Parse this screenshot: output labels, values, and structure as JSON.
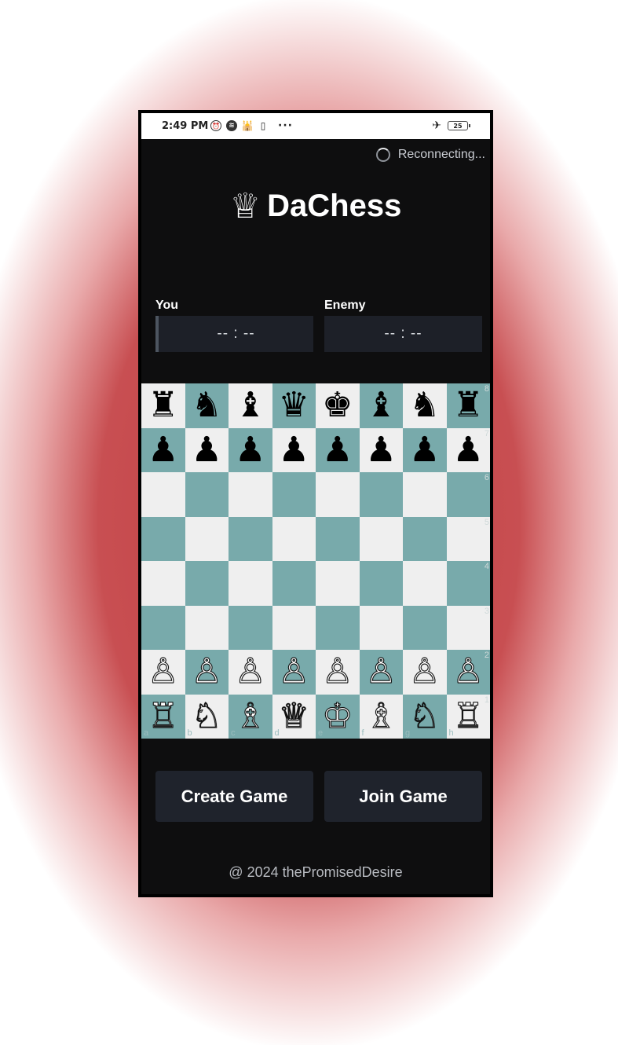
{
  "status_bar": {
    "time": "2:49 PM",
    "icons": [
      "alarm-icon",
      "spotify-icon",
      "mosque-icon",
      "twitch-icon"
    ],
    "more": "···",
    "battery": "25",
    "airplane": "✈"
  },
  "connection": {
    "status": "Reconnecting..."
  },
  "app": {
    "logo_glyph": "♕",
    "title": "DaChess"
  },
  "players": {
    "you": {
      "label": "You",
      "timer": "-- : --"
    },
    "enemy": {
      "label": "Enemy",
      "timer": "-- : --"
    }
  },
  "board": {
    "colors": {
      "light": "#efefef",
      "dark": "#78aaab"
    },
    "files": [
      "a",
      "b",
      "c",
      "d",
      "e",
      "f",
      "g",
      "h"
    ],
    "ranks": [
      "8",
      "7",
      "6",
      "5",
      "4",
      "3",
      "2",
      "1"
    ],
    "position": [
      [
        "♜",
        "♞",
        "♝",
        "♛",
        "♚",
        "♝",
        "♞",
        "♜"
      ],
      [
        "♟",
        "♟",
        "♟",
        "♟",
        "♟",
        "♟",
        "♟",
        "♟"
      ],
      [
        "",
        "",
        "",
        "",
        "",
        "",
        "",
        ""
      ],
      [
        "",
        "",
        "",
        "",
        "",
        "",
        "",
        ""
      ],
      [
        "",
        "",
        "",
        "",
        "",
        "",
        "",
        ""
      ],
      [
        "",
        "",
        "",
        "",
        "",
        "",
        "",
        ""
      ],
      [
        "♙",
        "♙",
        "♙",
        "♙",
        "♙",
        "♙",
        "♙",
        "♙"
      ],
      [
        "♖",
        "♘",
        "♗",
        "♕",
        "♔",
        "♗",
        "♘",
        "♖"
      ]
    ]
  },
  "actions": {
    "create": "Create Game",
    "join": "Join Game"
  },
  "footer": {
    "text": "@ 2024 thePromisedDesire"
  }
}
